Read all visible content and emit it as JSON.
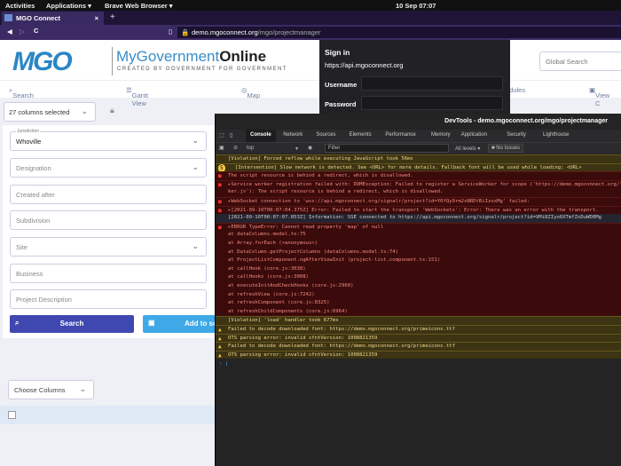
{
  "os": {
    "activities": "Activities",
    "applications": "Applications ▾",
    "browser": "Brave Web Browser ▾",
    "clock": "10 Sep  07:07"
  },
  "browser": {
    "tab_title": "MGO Connect",
    "close": "×",
    "new_tab": "+",
    "url_host": "demo.mgoconnect.org",
    "url_path": "/mgo/projectmanager"
  },
  "header": {
    "logo": "MGO",
    "brand_a": "MyGovernment",
    "brand_b": "Online",
    "tagline": "CREATED BY GOVERNMENT FOR GOVERNMENT",
    "global_search_placeholder": "Global Search"
  },
  "nav": {
    "search": "Search",
    "gantt": "Gantt View",
    "map": "Map",
    "schedules": "edules",
    "view": "View C"
  },
  "toolbar": {
    "columns": "27 columns selected"
  },
  "form": {
    "jurisdiction_label": "Jurisdiction",
    "jurisdiction": "Whoville",
    "designation": "Designation",
    "created_after": "Created after",
    "subdivision": "Subdivision",
    "site": "Site",
    "business": "Business",
    "project_description": "Project Description",
    "search_btn": "Search",
    "add_btn": "Add to sc"
  },
  "table": {
    "choose_columns": "Choose Columns"
  },
  "signin": {
    "title": "Sign in",
    "origin": "https://api.mgoconnect.org",
    "username": "Username",
    "password": "Password"
  },
  "devtools": {
    "title": "DevTools - demo.mgoconnect.org/mgo/projectmanager",
    "tabs": [
      "Console",
      "Network",
      "Sources",
      "Elements",
      "Performance",
      "Memory",
      "Application",
      "Security",
      "Lighthouse"
    ],
    "context": "top",
    "filter": "Filter",
    "levels": "All levels ▾",
    "issues": "No Issues",
    "badge": "5",
    "lines": [
      {
        "t": "warn",
        "x": "[Violation] Forced reflow while executing JavaScript took 56ms"
      },
      {
        "t": "warn",
        "x": "[Intervention] Slow network is detected. See <URL> for more details. Fallback font will be used while loading: <URL>"
      },
      {
        "t": "err",
        "x": "The script resource is behind a redirect, which is disallowed."
      },
      {
        "t": "err",
        "x": "▸Service worker registration failed with: DOMException: Failed to register a ServiceWorker for scope ('https://demo.mgoconnect.org/') with"
      },
      {
        "t": "err2",
        "x": "ker.js'): The script resource is behind a redirect, which is disallowed."
      },
      {
        "t": "err",
        "x": "▸WebSocket connection to 'wss://api.mgoconnect.org/signalr/project?id=Y6fQy9rm2xNRDtBiIzoxMg' failed:"
      },
      {
        "t": "err",
        "x": "▸[2021-09-10T00:07:04.375Z] Error: Failed to start the transport 'WebSockets': Error: There was an error with the transport."
      },
      {
        "t": "info",
        "x": "[2021-09-10T00:07:07.053Z] Information: SSE connected to https://api.mgoconnect.org/signalr/project?id=VMi8ZIyo6XTmfZoDuWD0Mg"
      },
      {
        "t": "err",
        "x": "▸ERROR TypeError: Cannot read property 'map' of null"
      },
      {
        "t": "err2",
        "x": "      at dataColumns.model.ts:75"
      },
      {
        "t": "err2",
        "x": "      at Array.forEach (<anonymous>)"
      },
      {
        "t": "err2",
        "x": "      at DataColumn.getProjectColumns (dataColumns.model.ts:74)"
      },
      {
        "t": "err2",
        "x": "      at ProjectListComponent.ngAfterViewInit (project-list.component.ts:151)"
      },
      {
        "t": "err2",
        "x": "      at callHook (core.js:3038)"
      },
      {
        "t": "err2",
        "x": "      at callHooks (core.js:3008)"
      },
      {
        "t": "err2",
        "x": "      at executeInitAndCheckHooks (core.js:2960)"
      },
      {
        "t": "err2",
        "x": "      at refreshView (core.js:7242)"
      },
      {
        "t": "err2",
        "x": "      at refreshComponent (core.js:8325)"
      },
      {
        "t": "err2",
        "x": "      at refreshChildComponents (core.js:6964)"
      },
      {
        "t": "warn",
        "x": "[Violation] 'load' handler took 677ms"
      },
      {
        "t": "warn",
        "x": "Failed to decode downloaded font: https://demo.mgoconnect.org/primeicons.ttf"
      },
      {
        "t": "warn",
        "x": "OTS parsing error: invalid sfntVersion: 1008821359"
      },
      {
        "t": "warn",
        "x": "Failed to decode downloaded font: https://demo.mgoconnect.org/primeicons.ttf"
      },
      {
        "t": "warn",
        "x": "OTS parsing error: invalid sfntVersion: 1008821359"
      }
    ]
  }
}
